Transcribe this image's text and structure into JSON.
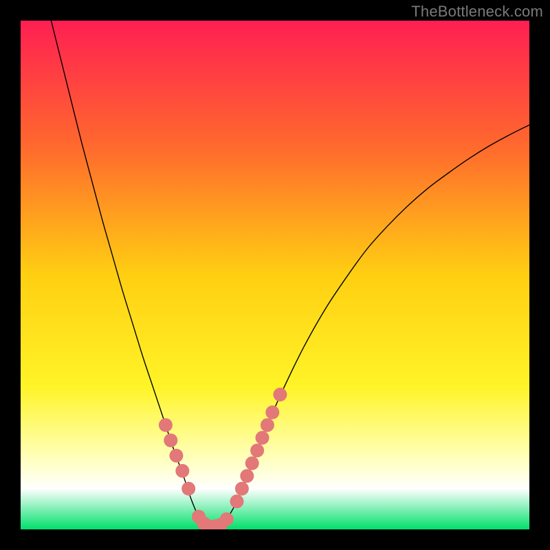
{
  "watermark": "TheBottleneck.com",
  "chart_data": {
    "type": "line",
    "title": "",
    "xlabel": "",
    "ylabel": "",
    "xlim": [
      0,
      100
    ],
    "ylim": [
      0,
      100
    ],
    "background_gradient": {
      "stops": [
        {
          "offset": 0,
          "color": "#ff1f52"
        },
        {
          "offset": 25,
          "color": "#ff6a2d"
        },
        {
          "offset": 50,
          "color": "#ffcf12"
        },
        {
          "offset": 72,
          "color": "#fff427"
        },
        {
          "offset": 85,
          "color": "#ffffb0"
        },
        {
          "offset": 92,
          "color": "#ffffff"
        },
        {
          "offset": 100,
          "color": "#00e06a"
        }
      ]
    },
    "series": [
      {
        "name": "bottleneck-curve",
        "color": "#000000",
        "stroke_width": 1.4,
        "points": [
          {
            "x": 6.0,
            "y": 100.0
          },
          {
            "x": 8.0,
            "y": 92.0
          },
          {
            "x": 10.0,
            "y": 84.0
          },
          {
            "x": 12.0,
            "y": 76.0
          },
          {
            "x": 14.0,
            "y": 68.5
          },
          {
            "x": 16.0,
            "y": 61.0
          },
          {
            "x": 18.0,
            "y": 54.0
          },
          {
            "x": 20.0,
            "y": 47.0
          },
          {
            "x": 22.0,
            "y": 40.5
          },
          {
            "x": 24.0,
            "y": 34.0
          },
          {
            "x": 26.0,
            "y": 28.0
          },
          {
            "x": 28.0,
            "y": 22.0
          },
          {
            "x": 30.0,
            "y": 16.0
          },
          {
            "x": 32.0,
            "y": 10.5
          },
          {
            "x": 33.5,
            "y": 6.0
          },
          {
            "x": 35.0,
            "y": 2.5
          },
          {
            "x": 36.5,
            "y": 0.8
          },
          {
            "x": 38.0,
            "y": 0.5
          },
          {
            "x": 40.0,
            "y": 1.5
          },
          {
            "x": 42.0,
            "y": 4.5
          },
          {
            "x": 44.0,
            "y": 9.0
          },
          {
            "x": 46.0,
            "y": 14.0
          },
          {
            "x": 48.0,
            "y": 19.0
          },
          {
            "x": 50.0,
            "y": 24.0
          },
          {
            "x": 53.0,
            "y": 30.5
          },
          {
            "x": 56.0,
            "y": 36.5
          },
          {
            "x": 60.0,
            "y": 43.5
          },
          {
            "x": 64.0,
            "y": 49.5
          },
          {
            "x": 68.0,
            "y": 55.0
          },
          {
            "x": 72.0,
            "y": 59.5
          },
          {
            "x": 76.0,
            "y": 63.5
          },
          {
            "x": 80.0,
            "y": 67.0
          },
          {
            "x": 84.0,
            "y": 70.0
          },
          {
            "x": 88.0,
            "y": 72.8
          },
          {
            "x": 92.0,
            "y": 75.3
          },
          {
            "x": 96.0,
            "y": 77.5
          },
          {
            "x": 100.0,
            "y": 79.5
          }
        ]
      },
      {
        "name": "highlight-markers",
        "color": "#e27878",
        "marker_radius": 10,
        "points": [
          {
            "x": 28.5,
            "y": 20.5
          },
          {
            "x": 29.5,
            "y": 17.5
          },
          {
            "x": 30.6,
            "y": 14.5
          },
          {
            "x": 31.8,
            "y": 11.5
          },
          {
            "x": 33.0,
            "y": 8.0
          },
          {
            "x": 35.0,
            "y": 2.5
          },
          {
            "x": 36.0,
            "y": 1.2
          },
          {
            "x": 37.0,
            "y": 0.6
          },
          {
            "x": 38.2,
            "y": 0.6
          },
          {
            "x": 39.3,
            "y": 0.9
          },
          {
            "x": 40.5,
            "y": 2.0
          },
          {
            "x": 42.5,
            "y": 5.5
          },
          {
            "x": 43.5,
            "y": 8.0
          },
          {
            "x": 44.5,
            "y": 10.5
          },
          {
            "x": 45.5,
            "y": 13.0
          },
          {
            "x": 46.5,
            "y": 15.5
          },
          {
            "x": 47.5,
            "y": 18.0
          },
          {
            "x": 48.5,
            "y": 20.5
          },
          {
            "x": 49.5,
            "y": 23.0
          },
          {
            "x": 51.0,
            "y": 26.5
          }
        ]
      }
    ]
  }
}
